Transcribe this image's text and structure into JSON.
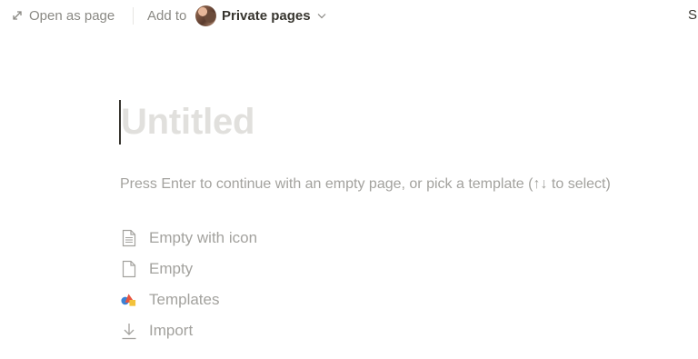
{
  "topbar": {
    "open_as_page_label": "Open as page",
    "add_to_label": "Add to",
    "workspace_label": "Private pages",
    "share_label_cut": "S"
  },
  "page": {
    "title_placeholder": "Untitled",
    "hint": "Press Enter to continue with an empty page, or pick a template (↑↓ to select)"
  },
  "options": [
    {
      "label": "Empty with icon",
      "icon": "page-with-lines-icon"
    },
    {
      "label": "Empty",
      "icon": "blank-page-icon"
    },
    {
      "label": "Templates",
      "icon": "templates-shapes-icon"
    },
    {
      "label": "Import",
      "icon": "import-arrow-icon"
    }
  ],
  "colors": {
    "text_muted": "#8a8984",
    "placeholder": "#e1e0dd",
    "hint": "#a3a29e",
    "text_primary": "#37352f"
  }
}
